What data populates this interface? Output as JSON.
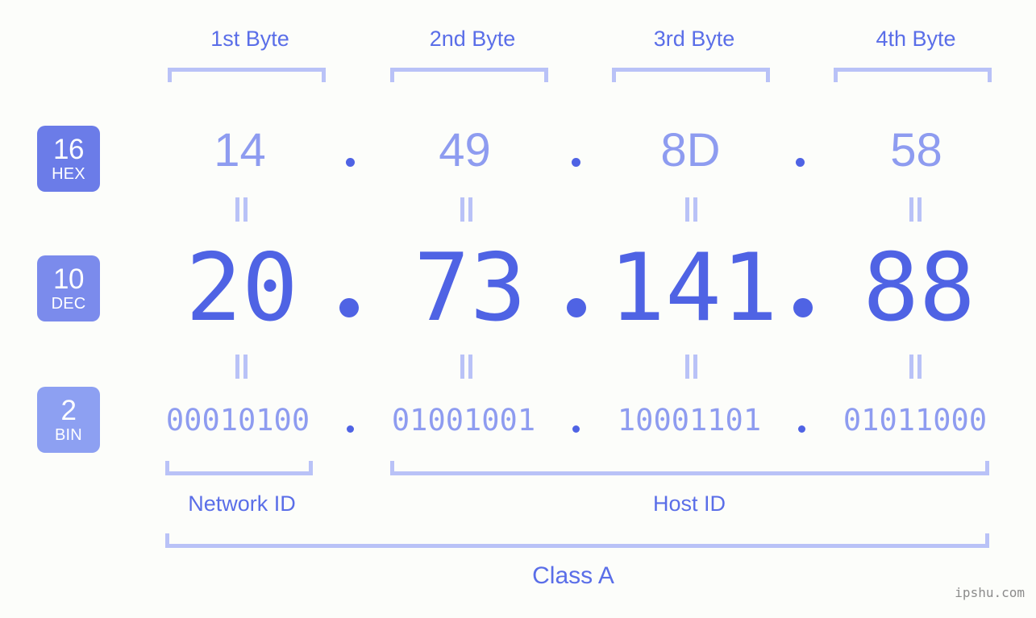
{
  "meta": {
    "background_color": "#fcfdfa",
    "accent_strong": "#4f63e4",
    "accent_light": "#8e9cf0",
    "bracket_color": "#b9c2f7",
    "badge_color_hex": "#6b7ce8",
    "badge_color_dec": "#7b8bec",
    "badge_color_bin": "#8da0f2",
    "watermark": "ipshu.com"
  },
  "byte_headers": [
    {
      "label": "1st Byte"
    },
    {
      "label": "2nd Byte"
    },
    {
      "label": "3rd Byte"
    },
    {
      "label": "4th Byte"
    }
  ],
  "rows": {
    "hex": {
      "badge_num": "16",
      "badge_label": "HEX",
      "values": [
        "14",
        "49",
        "8D",
        "58"
      ],
      "separator": "."
    },
    "dec": {
      "badge_num": "10",
      "badge_label": "DEC",
      "values": [
        "20",
        "73",
        "141",
        "88"
      ],
      "separator": "."
    },
    "bin": {
      "badge_num": "2",
      "badge_label": "BIN",
      "values": [
        "00010100",
        "01001001",
        "10001101",
        "01011000"
      ],
      "separator": "."
    }
  },
  "equivalence_marks": [
    "=",
    "=",
    "=",
    "=",
    "=",
    "=",
    "=",
    "="
  ],
  "id_sections": [
    {
      "label": "Network ID"
    },
    {
      "label": "Host ID"
    }
  ],
  "class_section": {
    "label": "Class A"
  }
}
